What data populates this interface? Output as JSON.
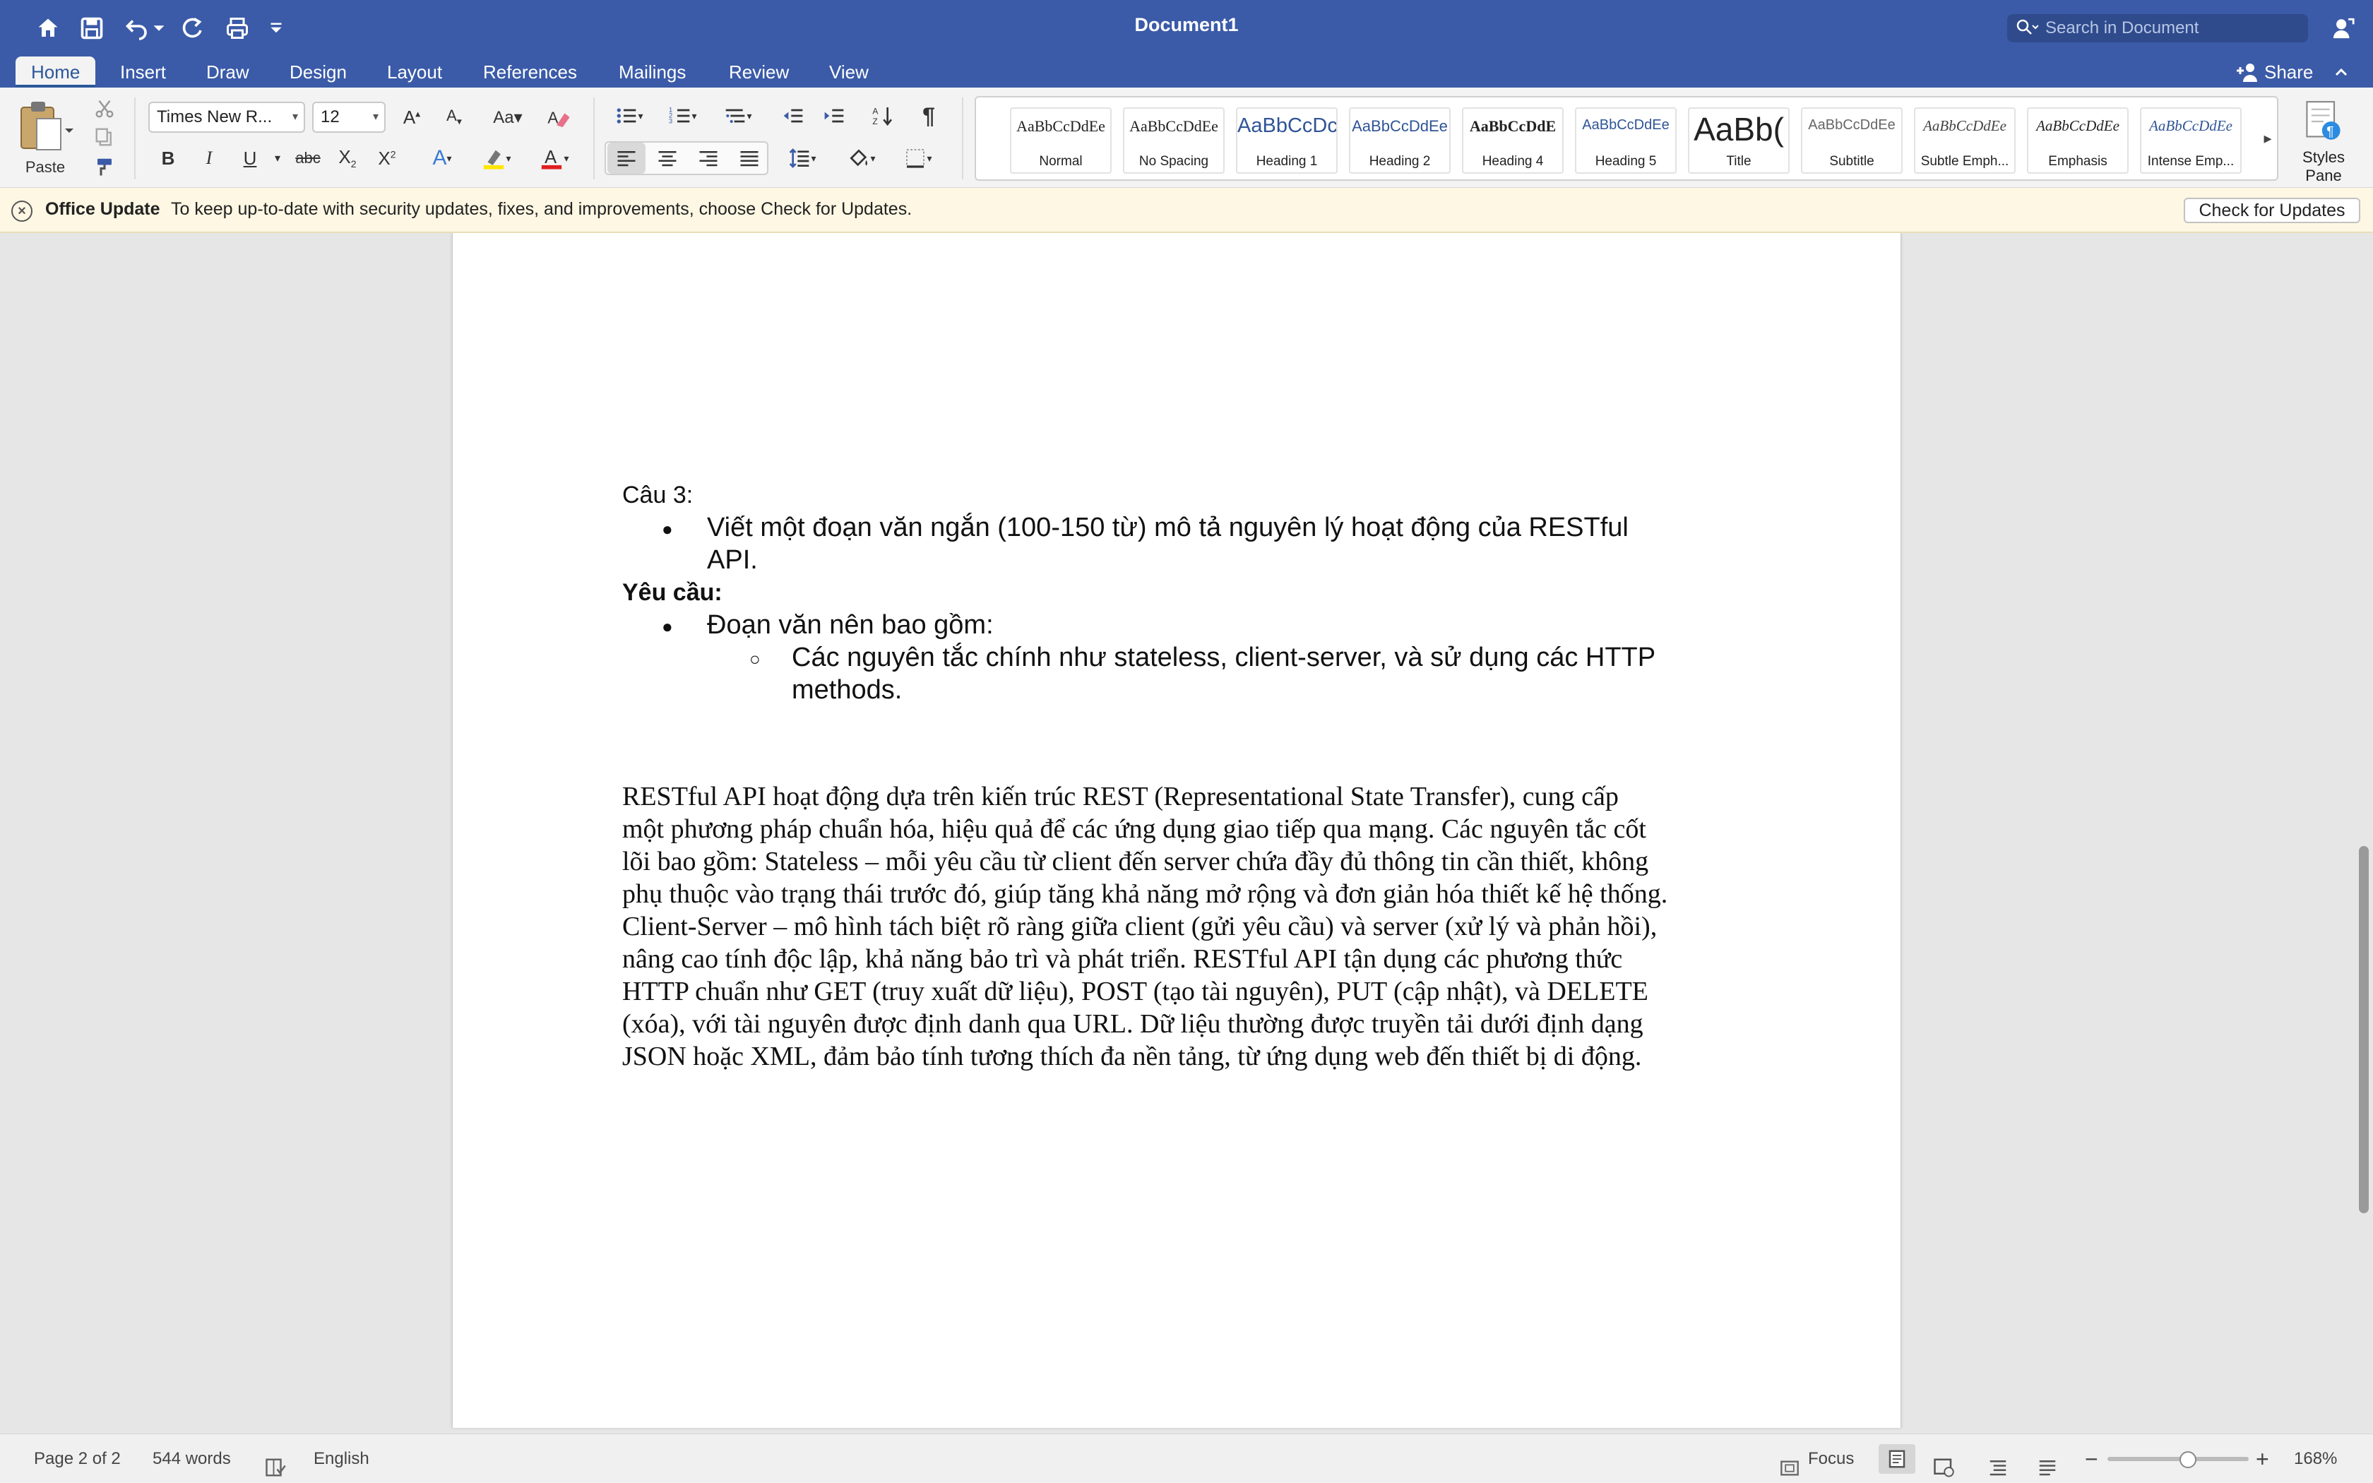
{
  "app": {
    "document_title": "Document1",
    "search_placeholder": "Search in Document"
  },
  "tabs": [
    {
      "label": "Home",
      "active": true
    },
    {
      "label": "Insert"
    },
    {
      "label": "Draw"
    },
    {
      "label": "Design"
    },
    {
      "label": "Layout"
    },
    {
      "label": "References"
    },
    {
      "label": "Mailings"
    },
    {
      "label": "Review"
    },
    {
      "label": "View"
    }
  ],
  "share_label": "Share",
  "ribbon": {
    "paste_label": "Paste",
    "font_name": "Times New R...",
    "font_size": "12",
    "styles_pane_label": "Styles Pane",
    "styles": [
      {
        "sample": "AaBbCcDdEe",
        "name": "Normal"
      },
      {
        "sample": "AaBbCcDdEe",
        "name": "No Spacing"
      },
      {
        "sample": "AaBbCcDc",
        "name": "Heading 1"
      },
      {
        "sample": "AaBbCcDdEe",
        "name": "Heading 2"
      },
      {
        "sample": "AaBbCcDdE",
        "name": "Heading 4"
      },
      {
        "sample": "AaBbCcDdEe",
        "name": "Heading 5"
      },
      {
        "sample": "AaBb(",
        "name": "Title"
      },
      {
        "sample": "AaBbCcDdEe",
        "name": "Subtitle"
      },
      {
        "sample": "AaBbCcDdEe",
        "name": "Subtle Emph..."
      },
      {
        "sample": "AaBbCcDdEe",
        "name": "Emphasis"
      },
      {
        "sample": "AaBbCcDdEe",
        "name": "Intense Emp..."
      }
    ],
    "accent_color": "#2b579a",
    "font_color": "#e02020",
    "highlight_color": "#ffe600"
  },
  "message_bar": {
    "title": "Office Update",
    "text": "To keep up-to-date with security updates, fixes, and improvements, choose Check for Updates.",
    "button": "Check for Updates"
  },
  "document": {
    "question": "Câu 3:",
    "bullet1_line1": "Viết một đoạn văn ngắn (100-150 từ) mô tả nguyên lý hoạt động của RESTful",
    "bullet1_line2": "API.",
    "requirement": "Yêu cầu:",
    "bullet2": "Đoạn văn nên bao gồm:",
    "sub_bullet_line1": "Các nguyên tắc chính như stateless, client-server, và sử dụng các HTTP",
    "sub_bullet_line2": "methods.",
    "paragraph_lines": [
      "RESTful API hoạt động dựa trên kiến trúc REST (Representational State Transfer), cung cấp",
      "một phương pháp chuẩn hóa, hiệu quả để các ứng dụng giao tiếp qua mạng. Các nguyên tắc cốt",
      "lõi bao gồm: Stateless – mỗi yêu cầu từ client đến server chứa đầy đủ thông tin cần thiết, không",
      "phụ thuộc vào trạng thái trước đó, giúp tăng khả năng mở rộng và đơn giản hóa thiết kế hệ thống.",
      "Client-Server – mô hình tách biệt rõ ràng giữa client (gửi yêu cầu) và server (xử lý và phản hồi),",
      "nâng cao tính độc lập, khả năng bảo trì và phát triển. RESTful API tận dụng các phương thức",
      "HTTP chuẩn như GET (truy xuất dữ liệu), POST (tạo tài nguyên), PUT (cập nhật), và DELETE",
      "(xóa), với tài nguyên được định danh qua URL. Dữ liệu thường được truyền tải dưới định dạng",
      "JSON hoặc XML, đảm bảo tính tương thích đa nền tảng, từ ứng dụng web đến thiết bị di động."
    ]
  },
  "status": {
    "page": "Page 2 of 2",
    "words": "544 words",
    "language": "English",
    "focus": "Focus",
    "zoom": "168%",
    "zoom_level_percent": 168
  }
}
